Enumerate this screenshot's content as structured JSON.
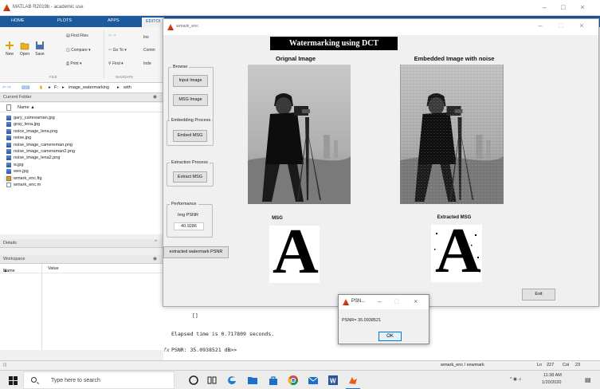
{
  "matlab": {
    "title": "MATLAB R2019b - academic use",
    "tabs": [
      "HOME",
      "PLOTS",
      "APPS",
      "EDITOR"
    ],
    "editor_cut": "EDITOI",
    "user_cut": "hal",
    "toolstrip": {
      "new": "New",
      "open": "Open",
      "save": "Save",
      "find_files": "Find Files",
      "compare": "Compare",
      "print": "Print",
      "go_to": "Go To",
      "find": "Find",
      "comm": "Comm",
      "ins": "Ins",
      "ind": "Inde",
      "group_file": "FILE",
      "group_navigate": "NAVIGATE"
    },
    "address": {
      "path_drive": "F:",
      "path_folder": "image_watermarking",
      "path_more": "with"
    },
    "current_folder": {
      "title": "Current Folder",
      "col_name": "Name",
      "sort": "▲",
      "files": [
        {
          "name": "gary_camreaman.jpg",
          "kind": "img"
        },
        {
          "name": "gray_lena.jpg",
          "kind": "img"
        },
        {
          "name": "noice_image_lena.png",
          "kind": "img"
        },
        {
          "name": "noise.jpg",
          "kind": "img"
        },
        {
          "name": "noise_image_camereman.png",
          "kind": "img"
        },
        {
          "name": "noise_image_cameraman2.png",
          "kind": "img"
        },
        {
          "name": "noise_image_lena2.png",
          "kind": "img"
        },
        {
          "name": "w.jpg",
          "kind": "img"
        },
        {
          "name": "wex.jpg",
          "kind": "img"
        },
        {
          "name": "wmark_enc.fig",
          "kind": "fig"
        },
        {
          "name": "wmark_enc.m",
          "kind": "m"
        }
      ]
    },
    "details": {
      "title": "Details"
    },
    "workspace": {
      "title": "Workspace",
      "col_name": "Name",
      "sort": "▲",
      "col_value": "Value"
    },
    "command": {
      "line1": "[]",
      "line2": "Elapsed time is 0.717809 seconds.",
      "prompt": "fx",
      "line3": "PSNR: 35.0938521 dB>>"
    },
    "status": {
      "left": "|||",
      "file": "wmark_enc / exwmark",
      "ln_label": "Ln",
      "ln": "227",
      "col_label": "Col",
      "col": "23"
    }
  },
  "figure": {
    "title": "wmark_enc",
    "banner": "Watermarking using DCT",
    "label_original": "Orignal Image",
    "label_embedded": "Embedded Image with noise",
    "label_msg": "MSG",
    "label_extracted": "Extracted MSG",
    "browse": {
      "title": "Browse",
      "input_btn": "Input Image",
      "msg_btn": "MSG Image"
    },
    "embedding": {
      "title": "Embedding Process",
      "btn": "Embed MSG"
    },
    "extraction": {
      "title": "Extraction Process",
      "btn": "Extract MSG"
    },
    "performance": {
      "title": "Performance",
      "label": "Img PSNR",
      "value": "40.9286"
    },
    "watermark_psnr_btn": "extracted watermark PSNR",
    "exit_btn": "Exit",
    "letter": "A"
  },
  "dialog": {
    "title": "PSN...",
    "message": "PSNR= 35.0938521",
    "ok": "OK"
  },
  "taskbar": {
    "search_placeholder": "Type here to search",
    "time": "11:38 AM",
    "date": "1/20/2020"
  },
  "colors": {
    "matlab_tab_bar": "#1c5a9c",
    "banner_bg": "#000000",
    "ok_border": "#0078d7"
  }
}
